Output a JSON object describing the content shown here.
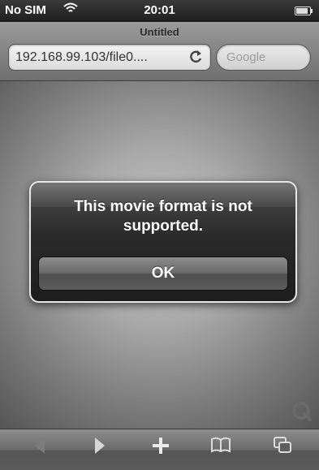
{
  "status_bar": {
    "carrier": "No SIM",
    "time": "20:01",
    "icons": [
      "wifi-icon",
      "battery-icon"
    ]
  },
  "browser": {
    "page_title": "Untitled",
    "url": "192.168.99.103/file0....",
    "search_placeholder": "Google",
    "reload_icon": "reload-icon"
  },
  "alert": {
    "message": "This movie format is not supported.",
    "button_label": "OK"
  },
  "content": {
    "badge_icon": "quicktime-icon"
  },
  "toolbar": {
    "items": [
      "back-icon",
      "forward-icon",
      "add-bookmark-icon",
      "bookmarks-icon",
      "pages-icon"
    ]
  },
  "colors": {
    "alert_background": "#1d1d1d",
    "alert_border": "#e8e8e8",
    "toolbar": "#6a6a6a"
  }
}
